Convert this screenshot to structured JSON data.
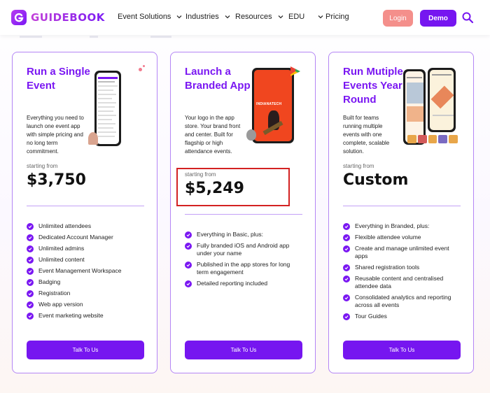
{
  "brand": {
    "name": "GUIDEBOOK"
  },
  "nav": {
    "items": [
      {
        "label": "Event Solutions",
        "has_dropdown": true
      },
      {
        "label": "Industries",
        "has_dropdown": true
      },
      {
        "label": "Resources",
        "has_dropdown": true
      },
      {
        "label": "EDU",
        "has_dropdown": true
      },
      {
        "label": "Pricing",
        "has_dropdown": false
      }
    ],
    "login_label": "Login",
    "demo_label": "Demo"
  },
  "colors": {
    "accent": "#7616f0",
    "login": "#f48f8b",
    "highlight": "#d32222"
  },
  "plans": [
    {
      "title": "Run a Single Event",
      "description": "Everything you need to launch one event app with simple pricing and no long term commitment.",
      "starting_label": "starting from",
      "price": "$3,750",
      "features": [
        "Unlimited attendees",
        "Dedicated Account Manager",
        "Unlimited admins",
        "Unlimited content",
        "Event Management Workspace",
        "Badging",
        "Registration",
        "Web app version",
        "Event marketing website"
      ],
      "cta": "Talk To Us"
    },
    {
      "title": "Launch a Branded App",
      "description": "Your logo in the app store. Your brand front and center. Built for flagship or high attendance events.",
      "starting_label": "starting from",
      "price": "$5,249",
      "phone_brand": "INDIANATECH",
      "features": [
        "Everything in Basic, plus:",
        "Fully branded iOS and Android app under your name",
        "Published in the app stores for long term engagement",
        "Detailed reporting included"
      ],
      "cta": "Talk To Us"
    },
    {
      "title": "Run Mutiple Events Year Round",
      "description": "Built for teams running multiple events with one complete, scalable solution.",
      "starting_label": "starting from",
      "price": "Custom",
      "features": [
        "Everything in Branded, plus:",
        "Flexible attendee volume",
        "Create and manage unlimited event apps",
        "Shared registration tools",
        "Reusable content and centralised attendee data",
        "Consolidated analytics and reporting across all events",
        "Tour Guides"
      ],
      "cta": "Talk To Us"
    }
  ]
}
